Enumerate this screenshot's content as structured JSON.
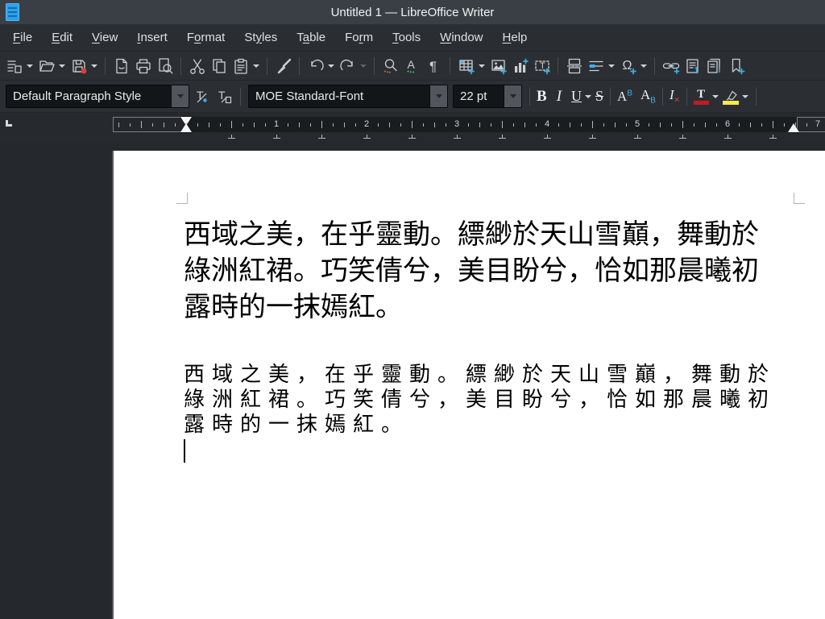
{
  "window": {
    "title": "Untitled 1 — LibreOffice Writer",
    "app_icon": "writer-document-icon"
  },
  "menubar": {
    "items": [
      {
        "pre": "",
        "key": "F",
        "post": "ile"
      },
      {
        "pre": "",
        "key": "E",
        "post": "dit"
      },
      {
        "pre": "",
        "key": "V",
        "post": "iew"
      },
      {
        "pre": "",
        "key": "I",
        "post": "nsert"
      },
      {
        "pre": "F",
        "key": "o",
        "post": "rmat"
      },
      {
        "pre": "St",
        "key": "y",
        "post": "les"
      },
      {
        "pre": "T",
        "key": "a",
        "post": "ble"
      },
      {
        "pre": "Fo",
        "key": "r",
        "post": "m"
      },
      {
        "pre": "",
        "key": "T",
        "post": "ools"
      },
      {
        "pre": "",
        "key": "W",
        "post": "indow"
      },
      {
        "pre": "",
        "key": "H",
        "post": "elp"
      }
    ]
  },
  "standard_toolbar": {
    "items": [
      {
        "type": "button",
        "name": "new-document",
        "dropdown": true
      },
      {
        "type": "button",
        "name": "open-file",
        "dropdown": true
      },
      {
        "type": "button",
        "name": "save",
        "dropdown": true
      },
      {
        "type": "sep"
      },
      {
        "type": "button",
        "name": "export-pdf"
      },
      {
        "type": "button",
        "name": "print"
      },
      {
        "type": "button",
        "name": "print-preview"
      },
      {
        "type": "sep"
      },
      {
        "type": "button",
        "name": "cut"
      },
      {
        "type": "button",
        "name": "copy"
      },
      {
        "type": "button",
        "name": "paste",
        "dropdown": true
      },
      {
        "type": "sep"
      },
      {
        "type": "button",
        "name": "clone-formatting"
      },
      {
        "type": "sep"
      },
      {
        "type": "button",
        "name": "undo",
        "dropdown": true
      },
      {
        "type": "button",
        "name": "redo",
        "dropdown": true,
        "dropdown_disabled": true
      },
      {
        "type": "sep"
      },
      {
        "type": "button",
        "name": "find-replace"
      },
      {
        "type": "button",
        "name": "spelling"
      },
      {
        "type": "button",
        "name": "formatting-marks"
      },
      {
        "type": "sep"
      },
      {
        "type": "button",
        "name": "insert-table",
        "dropdown": true
      },
      {
        "type": "button",
        "name": "insert-image"
      },
      {
        "type": "button",
        "name": "insert-chart"
      },
      {
        "type": "button",
        "name": "insert-textbox"
      },
      {
        "type": "sep"
      },
      {
        "type": "button",
        "name": "page-break"
      },
      {
        "type": "button",
        "name": "insert-field",
        "dropdown": true
      },
      {
        "type": "button",
        "name": "special-character",
        "dropdown": true
      },
      {
        "type": "sep"
      },
      {
        "type": "button",
        "name": "insert-hyperlink"
      },
      {
        "type": "button",
        "name": "insert-footnote"
      },
      {
        "type": "button",
        "name": "insert-endnote"
      },
      {
        "type": "button",
        "name": "insert-bookmark"
      }
    ]
  },
  "formatting_toolbar": {
    "paragraph_style_value": "Default Paragraph Style",
    "font_name_value": "MOE Standard-Font",
    "font_size_value": "22 pt",
    "bold_label": "B",
    "italic_label": "I",
    "underline_label": "U",
    "strikethrough_label": "S",
    "superscript_base": "A",
    "superscript_mark": "B",
    "subscript_base": "A",
    "subscript_mark": "B",
    "clear_formatting_base": "I",
    "clear_formatting_mark": "×",
    "font_color_label": "T",
    "update_style_label": "T",
    "new_style_label": "T"
  },
  "ruler": {
    "unit_numbers": [
      "1",
      "2",
      "3",
      "4",
      "5",
      "6",
      "7"
    ],
    "tab_type": "L"
  },
  "document": {
    "paragraph1": {
      "lines": [
        "西域之美，在乎靈動。縹緲於天山雪巔，舞動於",
        "綠洲紅裙。巧笑倩兮，美目盼兮，恰如那晨曦初",
        "露時的一抹嫣紅。"
      ]
    },
    "paragraph2": {
      "lines": [
        "西域之美，在乎靈動。縹緲於天山雪巔，舞動於",
        "綠洲紅裙。巧笑倩兮，美目盼兮，恰如那晨曦初",
        "露時的一抹嫣紅。"
      ]
    }
  },
  "colors": {
    "accent_blue": "#3daee9",
    "titlebar": "#3a3f45",
    "toolbar": "#2b2f34",
    "page": "#ffffff",
    "text": "#000000",
    "save_badge_red": "#e23c3c",
    "font_color_red": "#c01c28",
    "highlight_yellow": "#fce94f"
  }
}
